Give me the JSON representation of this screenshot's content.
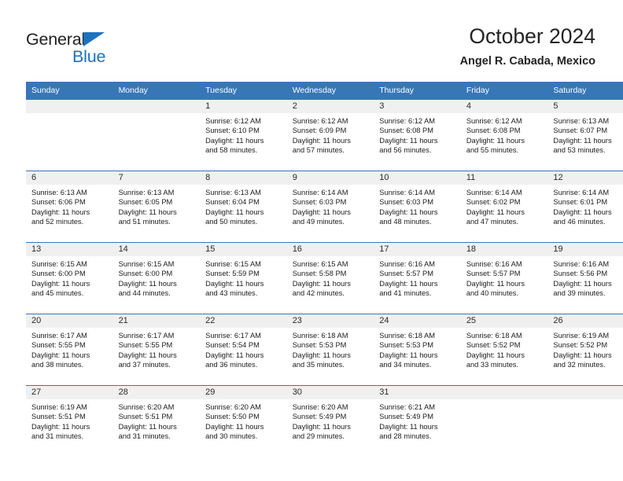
{
  "brand": {
    "name_top": "General",
    "name_bottom": "Blue",
    "accent_color": "#1c72bd"
  },
  "header": {
    "title": "October 2024",
    "subtitle": "Angel R. Cabada, Mexico"
  },
  "theme": {
    "header_bar_color": "#3777b8",
    "day_number_bg": "#f0f0f0",
    "page_bg": "#ffffff"
  },
  "weekdays": [
    "Sunday",
    "Monday",
    "Tuesday",
    "Wednesday",
    "Thursday",
    "Friday",
    "Saturday"
  ],
  "weeks": [
    [
      {
        "day": "",
        "lines": []
      },
      {
        "day": "",
        "lines": []
      },
      {
        "day": "1",
        "lines": [
          "Sunrise: 6:12 AM",
          "Sunset: 6:10 PM",
          "Daylight: 11 hours",
          "and 58 minutes."
        ]
      },
      {
        "day": "2",
        "lines": [
          "Sunrise: 6:12 AM",
          "Sunset: 6:09 PM",
          "Daylight: 11 hours",
          "and 57 minutes."
        ]
      },
      {
        "day": "3",
        "lines": [
          "Sunrise: 6:12 AM",
          "Sunset: 6:08 PM",
          "Daylight: 11 hours",
          "and 56 minutes."
        ]
      },
      {
        "day": "4",
        "lines": [
          "Sunrise: 6:12 AM",
          "Sunset: 6:08 PM",
          "Daylight: 11 hours",
          "and 55 minutes."
        ]
      },
      {
        "day": "5",
        "lines": [
          "Sunrise: 6:13 AM",
          "Sunset: 6:07 PM",
          "Daylight: 11 hours",
          "and 53 minutes."
        ]
      }
    ],
    [
      {
        "day": "6",
        "lines": [
          "Sunrise: 6:13 AM",
          "Sunset: 6:06 PM",
          "Daylight: 11 hours",
          "and 52 minutes."
        ]
      },
      {
        "day": "7",
        "lines": [
          "Sunrise: 6:13 AM",
          "Sunset: 6:05 PM",
          "Daylight: 11 hours",
          "and 51 minutes."
        ]
      },
      {
        "day": "8",
        "lines": [
          "Sunrise: 6:13 AM",
          "Sunset: 6:04 PM",
          "Daylight: 11 hours",
          "and 50 minutes."
        ]
      },
      {
        "day": "9",
        "lines": [
          "Sunrise: 6:14 AM",
          "Sunset: 6:03 PM",
          "Daylight: 11 hours",
          "and 49 minutes."
        ]
      },
      {
        "day": "10",
        "lines": [
          "Sunrise: 6:14 AM",
          "Sunset: 6:03 PM",
          "Daylight: 11 hours",
          "and 48 minutes."
        ]
      },
      {
        "day": "11",
        "lines": [
          "Sunrise: 6:14 AM",
          "Sunset: 6:02 PM",
          "Daylight: 11 hours",
          "and 47 minutes."
        ]
      },
      {
        "day": "12",
        "lines": [
          "Sunrise: 6:14 AM",
          "Sunset: 6:01 PM",
          "Daylight: 11 hours",
          "and 46 minutes."
        ]
      }
    ],
    [
      {
        "day": "13",
        "lines": [
          "Sunrise: 6:15 AM",
          "Sunset: 6:00 PM",
          "Daylight: 11 hours",
          "and 45 minutes."
        ]
      },
      {
        "day": "14",
        "lines": [
          "Sunrise: 6:15 AM",
          "Sunset: 6:00 PM",
          "Daylight: 11 hours",
          "and 44 minutes."
        ]
      },
      {
        "day": "15",
        "lines": [
          "Sunrise: 6:15 AM",
          "Sunset: 5:59 PM",
          "Daylight: 11 hours",
          "and 43 minutes."
        ]
      },
      {
        "day": "16",
        "lines": [
          "Sunrise: 6:15 AM",
          "Sunset: 5:58 PM",
          "Daylight: 11 hours",
          "and 42 minutes."
        ]
      },
      {
        "day": "17",
        "lines": [
          "Sunrise: 6:16 AM",
          "Sunset: 5:57 PM",
          "Daylight: 11 hours",
          "and 41 minutes."
        ]
      },
      {
        "day": "18",
        "lines": [
          "Sunrise: 6:16 AM",
          "Sunset: 5:57 PM",
          "Daylight: 11 hours",
          "and 40 minutes."
        ]
      },
      {
        "day": "19",
        "lines": [
          "Sunrise: 6:16 AM",
          "Sunset: 5:56 PM",
          "Daylight: 11 hours",
          "and 39 minutes."
        ]
      }
    ],
    [
      {
        "day": "20",
        "lines": [
          "Sunrise: 6:17 AM",
          "Sunset: 5:55 PM",
          "Daylight: 11 hours",
          "and 38 minutes."
        ]
      },
      {
        "day": "21",
        "lines": [
          "Sunrise: 6:17 AM",
          "Sunset: 5:55 PM",
          "Daylight: 11 hours",
          "and 37 minutes."
        ]
      },
      {
        "day": "22",
        "lines": [
          "Sunrise: 6:17 AM",
          "Sunset: 5:54 PM",
          "Daylight: 11 hours",
          "and 36 minutes."
        ]
      },
      {
        "day": "23",
        "lines": [
          "Sunrise: 6:18 AM",
          "Sunset: 5:53 PM",
          "Daylight: 11 hours",
          "and 35 minutes."
        ]
      },
      {
        "day": "24",
        "lines": [
          "Sunrise: 6:18 AM",
          "Sunset: 5:53 PM",
          "Daylight: 11 hours",
          "and 34 minutes."
        ]
      },
      {
        "day": "25",
        "lines": [
          "Sunrise: 6:18 AM",
          "Sunset: 5:52 PM",
          "Daylight: 11 hours",
          "and 33 minutes."
        ]
      },
      {
        "day": "26",
        "lines": [
          "Sunrise: 6:19 AM",
          "Sunset: 5:52 PM",
          "Daylight: 11 hours",
          "and 32 minutes."
        ]
      }
    ],
    [
      {
        "day": "27",
        "lines": [
          "Sunrise: 6:19 AM",
          "Sunset: 5:51 PM",
          "Daylight: 11 hours",
          "and 31 minutes."
        ]
      },
      {
        "day": "28",
        "lines": [
          "Sunrise: 6:20 AM",
          "Sunset: 5:51 PM",
          "Daylight: 11 hours",
          "and 31 minutes."
        ]
      },
      {
        "day": "29",
        "lines": [
          "Sunrise: 6:20 AM",
          "Sunset: 5:50 PM",
          "Daylight: 11 hours",
          "and 30 minutes."
        ]
      },
      {
        "day": "30",
        "lines": [
          "Sunrise: 6:20 AM",
          "Sunset: 5:49 PM",
          "Daylight: 11 hours",
          "and 29 minutes."
        ]
      },
      {
        "day": "31",
        "lines": [
          "Sunrise: 6:21 AM",
          "Sunset: 5:49 PM",
          "Daylight: 11 hours",
          "and 28 minutes."
        ]
      },
      {
        "day": "",
        "lines": []
      },
      {
        "day": "",
        "lines": []
      }
    ]
  ]
}
